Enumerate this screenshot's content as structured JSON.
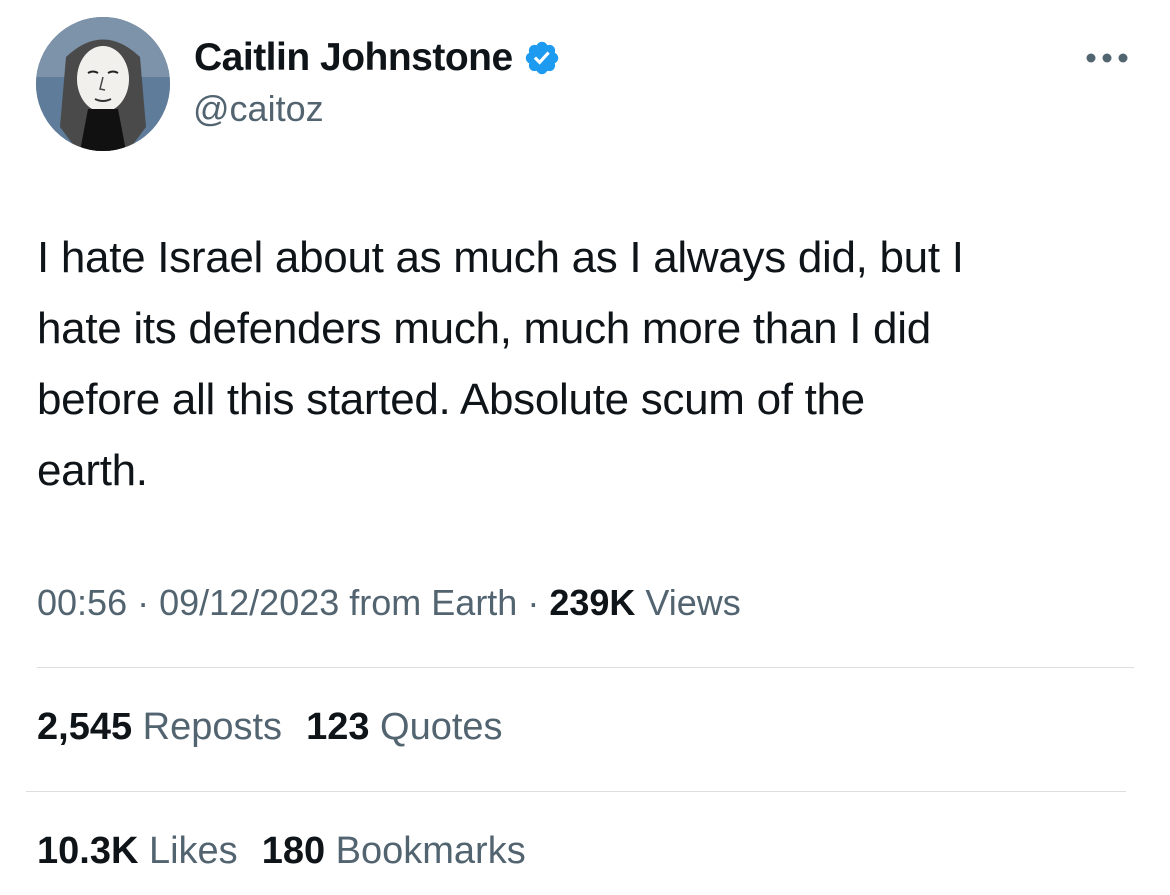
{
  "author": {
    "display_name": "Caitlin Johnstone",
    "handle": "@caitoz",
    "verified": true,
    "avatar_icon": "profile-avatar"
  },
  "more_icon": "ellipsis-icon",
  "tweet": {
    "lines": [
      "I hate Israel about as much as I always did, but I",
      "hate its defenders much, much more than I did",
      "before all this started. Absolute scum of the",
      "earth."
    ]
  },
  "meta": {
    "time": "00:56",
    "sep1": " · ",
    "date": "09/12/2023",
    "source": " from Earth",
    "sep2": " · ",
    "views_count": "239K",
    "views_label": " Views"
  },
  "stats": {
    "reposts_count": "2,545",
    "reposts_label": " Reposts",
    "quotes_count": "123",
    "quotes_label": " Quotes",
    "likes_count": "10.3K",
    "likes_label": " Likes",
    "bookmarks_count": "180",
    "bookmarks_label": " Bookmarks"
  },
  "colors": {
    "text_primary": "#0f1419",
    "text_secondary": "#536471",
    "verified_blue": "#1d9bf0",
    "divider": "#dcdfe2"
  }
}
